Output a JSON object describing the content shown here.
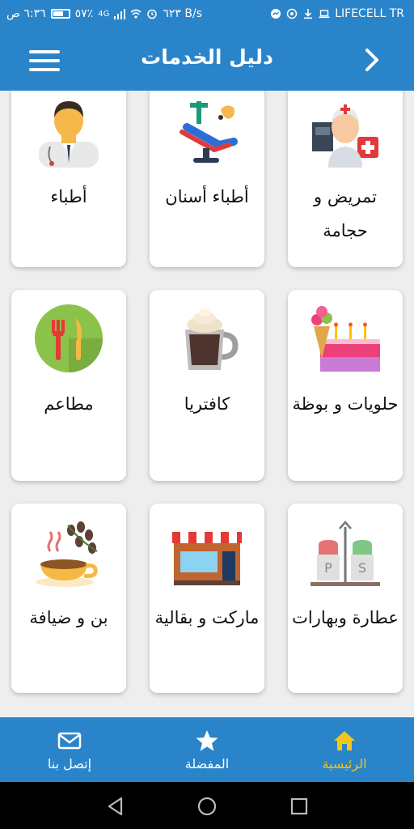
{
  "status_bar": {
    "time": "٦:٣٦ ص",
    "battery": "٥٧٪",
    "network_type": "4G",
    "speed": "٦٢٣ B/s",
    "carrier": "LIFECELL TR"
  },
  "header": {
    "title": "دليل الخدمات"
  },
  "cards": [
    {
      "label": "أطباء",
      "icon": "doctor-icon"
    },
    {
      "label": "أطباء أسنان",
      "icon": "dental-chair-icon"
    },
    {
      "label": "تمريض و حجامة",
      "icon": "nurse-icon"
    },
    {
      "label": "مطاعم",
      "icon": "restaurant-icon"
    },
    {
      "label": "كافتريا",
      "icon": "coffee-mug-icon"
    },
    {
      "label": "حلويات و بوظة",
      "icon": "cake-icecream-icon"
    },
    {
      "label": "بن و ضيافة",
      "icon": "coffee-cup-icon"
    },
    {
      "label": "ماركت و بقالية",
      "icon": "market-icon"
    },
    {
      "label": "عطارة وبهارات",
      "icon": "spices-icon"
    }
  ],
  "bottom_nav": [
    {
      "label": "إتصل بنا",
      "icon": "mail-icon",
      "active": false
    },
    {
      "label": "المفضلة",
      "icon": "star-icon",
      "active": false
    },
    {
      "label": "الرئيسية",
      "icon": "home-icon",
      "active": true
    }
  ],
  "colors": {
    "primary": "#2a84c9",
    "active_nav": "#f5c518"
  }
}
